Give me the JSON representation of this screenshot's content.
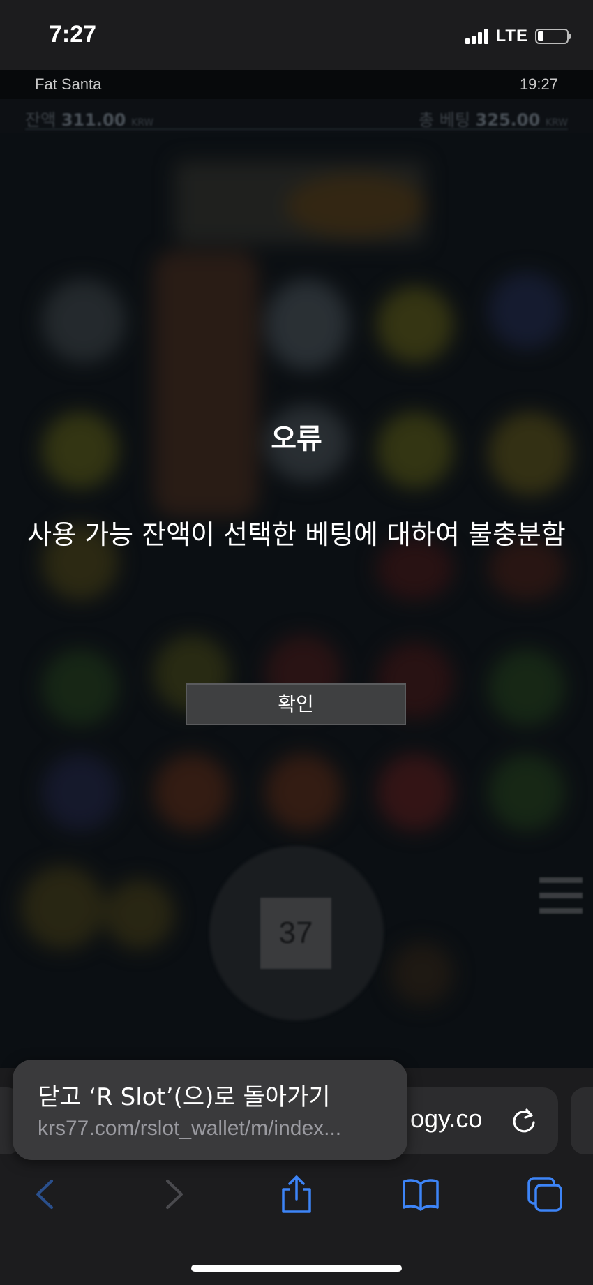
{
  "status_bar": {
    "time": "7:27",
    "network": "LTE",
    "battery_level": 0.2
  },
  "game": {
    "title": "Fat Santa",
    "clock": "19:27",
    "balance_label": "잔액",
    "balance_value": "311.00",
    "balance_currency": "KRW",
    "total_bet_label": "총 베팅",
    "total_bet_value": "325.00",
    "total_bet_currency": "KRW",
    "spin_counter": "37"
  },
  "dialog": {
    "title": "오류",
    "message": "사용 가능 잔액이 선택한 베팅에 대하여 불충분함",
    "ok_label": "확인"
  },
  "safari": {
    "back_tooltip_title": "닫고 ‘R Slot’(으)로 돌아가기",
    "back_tooltip_url": "krs77.com/rslot_wallet/m/index...",
    "url_domain": "ogy.co",
    "toolbar_icons": [
      "back-icon",
      "forward-icon",
      "share-icon",
      "bookmarks-icon",
      "tabs-icon"
    ],
    "accent_color": "#3d84f7"
  }
}
